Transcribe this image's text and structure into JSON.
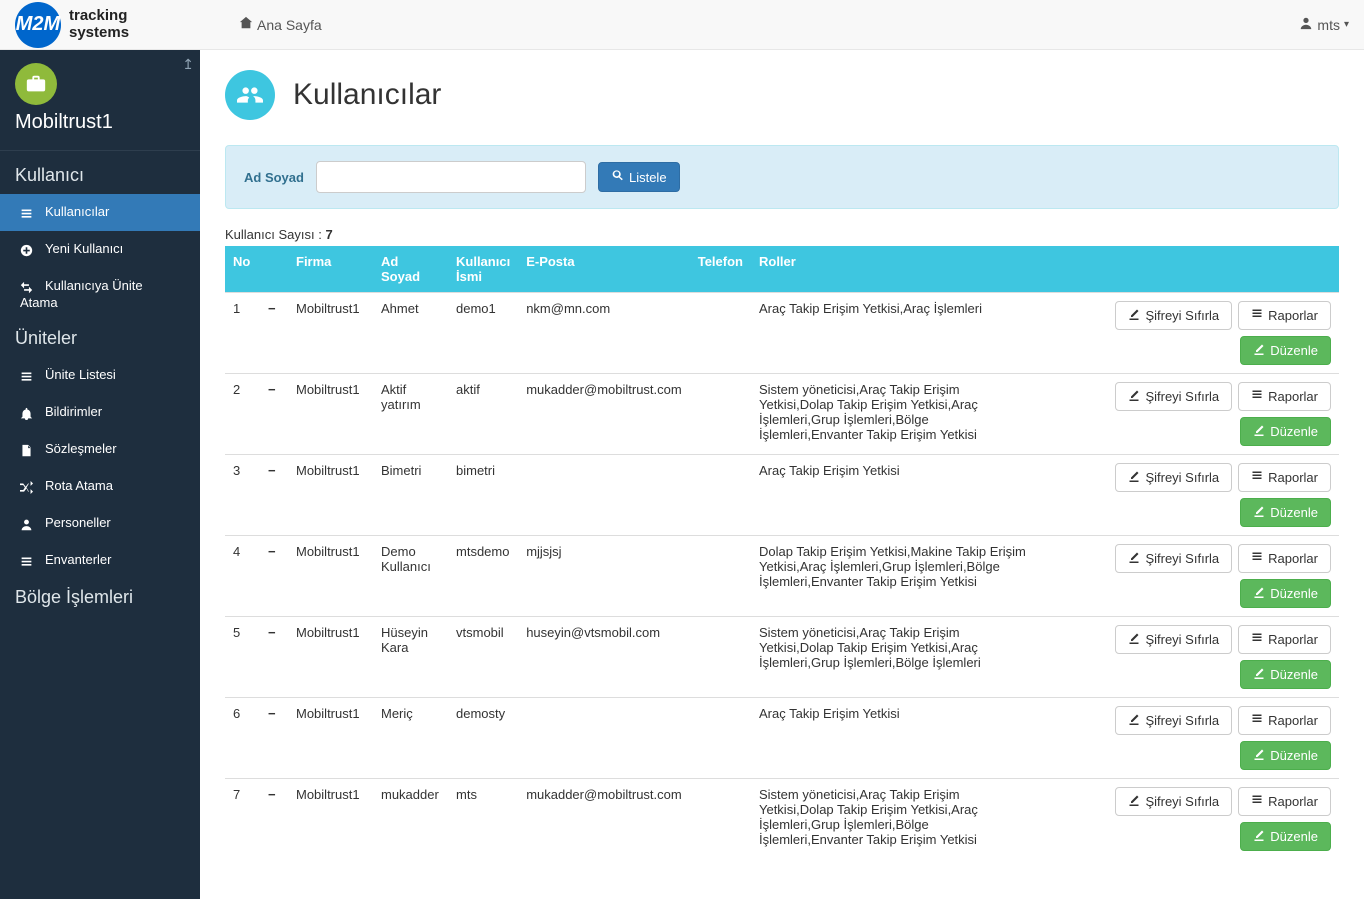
{
  "top": {
    "logo_text": "tracking\nsystems",
    "home": "Ana Sayfa",
    "user": "mts"
  },
  "brand": {
    "name": "Mobiltrust1"
  },
  "sidebar": {
    "sections": [
      {
        "title": "Kullanıcı",
        "items": [
          {
            "label": "Kullanıcılar",
            "active": true,
            "icon": "list"
          },
          {
            "label": "Yeni Kullanıcı",
            "icon": "plus"
          },
          {
            "label": "Kullanıcıya Ünite Atama",
            "icon": "transfer"
          }
        ]
      },
      {
        "title": "Üniteler",
        "items": [
          {
            "label": "Ünite Listesi",
            "icon": "list"
          },
          {
            "label": "Bildirimler",
            "icon": "bell"
          },
          {
            "label": "Sözleşmeler",
            "icon": "file"
          },
          {
            "label": "Rota Atama",
            "icon": "random"
          },
          {
            "label": "Personeller",
            "icon": "user"
          },
          {
            "label": "Envanterler",
            "icon": "list"
          }
        ]
      },
      {
        "title": "Bölge İşlemleri",
        "items": []
      }
    ]
  },
  "page": {
    "title": "Kullanıcılar",
    "filter_label": "Ad Soyad",
    "filter_placeholder": "",
    "list_button": "Listele",
    "count_label": "Kullanıcı Sayısı :",
    "count_value": "7"
  },
  "table": {
    "headers": {
      "no": "No",
      "firma": "Firma",
      "adsoyad": "Ad Soyad",
      "kullanici": "Kullanıcı İsmi",
      "eposta": "E-Posta",
      "telefon": "Telefon",
      "roller": "Roller"
    },
    "buttons": {
      "reset": "Şifreyi Sıfırla",
      "reports": "Raporlar",
      "edit": "Düzenle"
    },
    "rows": [
      {
        "no": "1",
        "firma": "Mobiltrust1",
        "ad": "Ahmet",
        "user": "demo1",
        "email": "nkm@mn.com",
        "tel": "",
        "roles": "Araç Takip Erişim Yetkisi,Araç İşlemleri"
      },
      {
        "no": "2",
        "firma": "Mobiltrust1",
        "ad": "Aktif yatırım",
        "user": "aktif",
        "email": "mukadder@mobiltrust.com",
        "tel": "",
        "roles": "Sistem yöneticisi,Araç Takip Erişim Yetkisi,Dolap Takip Erişim Yetkisi,Araç İşlemleri,Grup İşlemleri,Bölge İşlemleri,Envanter Takip Erişim Yetkisi"
      },
      {
        "no": "3",
        "firma": "Mobiltrust1",
        "ad": "Bimetri",
        "user": "bimetri",
        "email": "",
        "tel": "",
        "roles": "Araç Takip Erişim Yetkisi"
      },
      {
        "no": "4",
        "firma": "Mobiltrust1",
        "ad": "Demo Kullanıcı",
        "user": "mtsdemo",
        "email": "mjjsjsj",
        "tel": "",
        "roles": "Dolap Takip Erişim Yetkisi,Makine Takip Erişim Yetkisi,Araç İşlemleri,Grup İşlemleri,Bölge İşlemleri,Envanter Takip Erişim Yetkisi"
      },
      {
        "no": "5",
        "firma": "Mobiltrust1",
        "ad": "Hüseyin Kara",
        "user": "vtsmobil",
        "email": "huseyin@vtsmobil.com",
        "tel": "",
        "roles": "Sistem yöneticisi,Araç Takip Erişim Yetkisi,Dolap Takip Erişim Yetkisi,Araç İşlemleri,Grup İşlemleri,Bölge İşlemleri"
      },
      {
        "no": "6",
        "firma": "Mobiltrust1",
        "ad": "Meriç",
        "user": "demosty",
        "email": "",
        "tel": "",
        "roles": "Araç Takip Erişim Yetkisi"
      },
      {
        "no": "7",
        "firma": "Mobiltrust1",
        "ad": "mukadder",
        "user": "mts",
        "email": "mukadder@mobiltrust.com",
        "tel": "",
        "roles": "Sistem yöneticisi,Araç Takip Erişim Yetkisi,Dolap Takip Erişim Yetkisi,Araç İşlemleri,Grup İşlemleri,Bölge İşlemleri,Envanter Takip Erişim Yetkisi"
      }
    ]
  }
}
